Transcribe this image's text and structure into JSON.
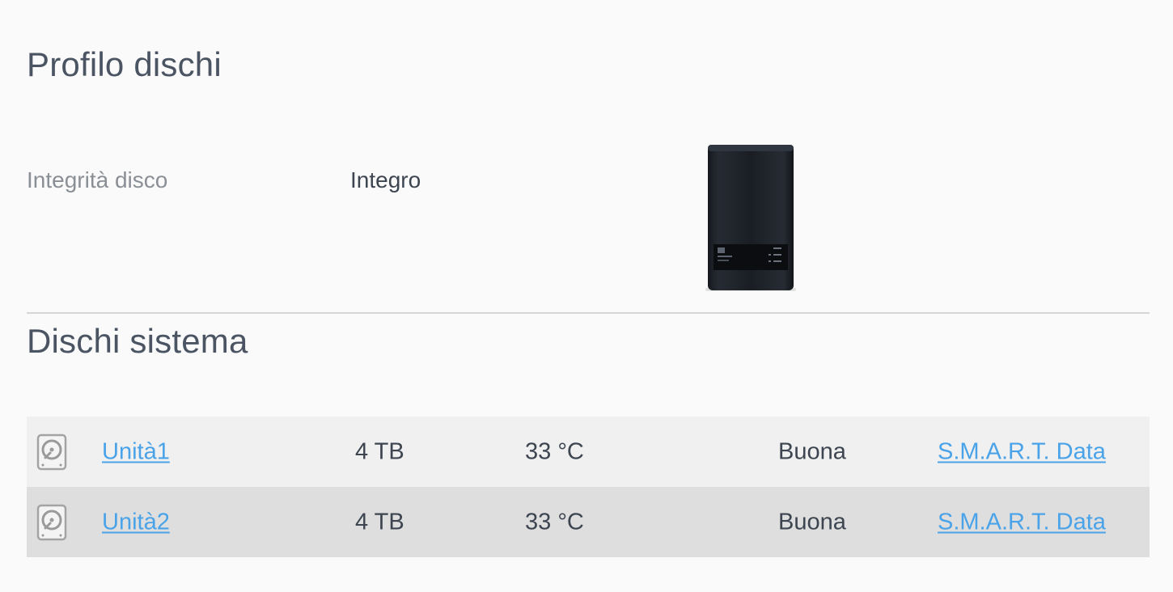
{
  "profile": {
    "title": "Profilo dischi",
    "health_label": "Integrità disco",
    "health_value": "Integro",
    "device_image": "nas-device"
  },
  "system": {
    "title": "Dischi sistema",
    "disks": [
      {
        "icon": "hard-drive-icon",
        "name": "Unità1",
        "size": "4 TB",
        "temperature": "33 °C",
        "status": "Buona",
        "smart_link": "S.M.A.R.T. Data"
      },
      {
        "icon": "hard-drive-icon",
        "name": "Unità2",
        "size": "4 TB",
        "temperature": "33 °C",
        "status": "Buona",
        "smart_link": "S.M.A.R.T. Data"
      }
    ]
  },
  "colors": {
    "background": "#fafafa",
    "link": "#4aa3e8",
    "row_odd": "#f0f0f0",
    "row_even": "#dedede",
    "title": "#4a5462",
    "muted_label": "#8a8f96"
  }
}
